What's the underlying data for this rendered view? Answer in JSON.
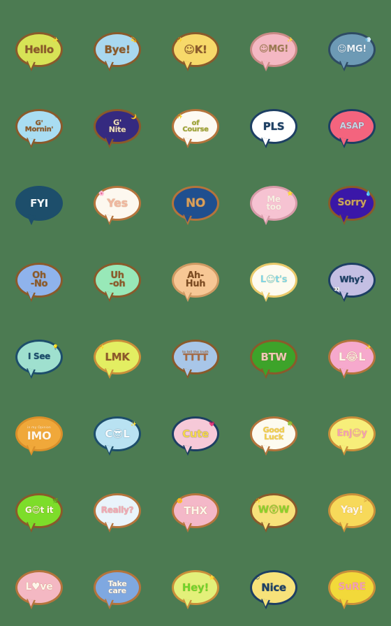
{
  "canvas": {
    "background_color": "#4c7b52",
    "columns": 5,
    "rows": 8,
    "total_stickers": 40
  },
  "stickers": [
    {
      "text": "Hello",
      "sub": "",
      "bubble_color": "#d7e356",
      "border_color": "#8a5a2b",
      "text_color": "#8a5a2b",
      "deco": "✨",
      "deco_pos": "tr",
      "font_size": "15px"
    },
    {
      "text": "Bye!",
      "sub": "",
      "bubble_color": "#a9d8ef",
      "border_color": "#8a5a2b",
      "text_color": "#8a5a2b",
      "deco": "💫",
      "deco_pos": "tr",
      "font_size": "15px"
    },
    {
      "text": "☺K!",
      "sub": "",
      "bubble_color": "#f7d96a",
      "border_color": "#8a5a2b",
      "text_color": "#8a5a2b",
      "deco": "✨",
      "deco_pos": "tl",
      "font_size": "15px"
    },
    {
      "text": "☺MG!",
      "sub": "",
      "bubble_color": "#f4b8c3",
      "border_color": "#c98a86",
      "text_color": "#9a7a52",
      "deco": "✨",
      "deco_pos": "tr",
      "font_size": "13px"
    },
    {
      "text": "☺MG!",
      "sub": "",
      "bubble_color": "#6d9ab5",
      "border_color": "#2e4b63",
      "text_color": "#eaf2f7",
      "deco": "💨",
      "deco_pos": "tr",
      "font_size": "13px"
    },
    {
      "text": "G'\nMornin'",
      "sub": "",
      "bubble_color": "#a9ddf2",
      "border_color": "#8a5a2b",
      "text_color": "#8a5a2b",
      "deco": "☀",
      "deco_pos": "tr",
      "font_size": "10px"
    },
    {
      "text": "G'\nNite",
      "sub": "",
      "bubble_color": "#352a80",
      "border_color": "#8a5a2b",
      "text_color": "#e8dcc0",
      "deco": "🌙",
      "deco_pos": "tr",
      "font_size": "11px"
    },
    {
      "text": "of\nCourse",
      "sub": "",
      "bubble_color": "#fdfaf2",
      "border_color": "#b4743c",
      "text_color": "#9aab3a",
      "deco": "✨",
      "deco_pos": "tl",
      "font_size": "10px"
    },
    {
      "text": "PLS",
      "sub": "",
      "bubble_color": "#ffffff",
      "border_color": "#1d3f63",
      "text_color": "#1d3f63",
      "deco": "✦",
      "deco_pos": "tr",
      "font_size": "15px"
    },
    {
      "text": "ASAP",
      "sub": "",
      "bubble_color": "#f4647e",
      "border_color": "#1d3f63",
      "text_color": "#c9d6e3",
      "deco": "",
      "deco_pos": "tr",
      "font_size": "12px"
    },
    {
      "text": "FYI",
      "sub": "",
      "bubble_color": "#1d4e6b",
      "border_color": "#1d4e6b",
      "text_color": "#eef4f7",
      "deco": "",
      "deco_pos": "tr",
      "font_size": "15px"
    },
    {
      "text": "Yes",
      "sub": "",
      "bubble_color": "#fdf8ef",
      "border_color": "#b4743c",
      "text_color": "#f0b8a0",
      "deco": "🌸",
      "deco_pos": "tl",
      "font_size": "16px"
    },
    {
      "text": "NO",
      "sub": "",
      "bubble_color": "#1f4f8f",
      "border_color": "#b4743c",
      "text_color": "#d9a05a",
      "deco": "",
      "deco_pos": "tr",
      "font_size": "17px"
    },
    {
      "text": "Me\ntoo",
      "sub": "",
      "bubble_color": "#f6c3d2",
      "border_color": "#d79aa8",
      "text_color": "#f7efe2",
      "deco": "⭐",
      "deco_pos": "tr",
      "font_size": "12px"
    },
    {
      "text": "Sorry",
      "sub": "",
      "bubble_color": "#3a17a8",
      "border_color": "#8a5a2b",
      "text_color": "#c9a45f",
      "deco": "💧",
      "deco_pos": "tr",
      "font_size": "14px"
    },
    {
      "text": "Oh\n-No",
      "sub": "",
      "bubble_color": "#8fb3ec",
      "border_color": "#8a5a2b",
      "text_color": "#8a5a2b",
      "deco": "",
      "deco_pos": "tr",
      "font_size": "13px"
    },
    {
      "text": "Uh\n-oh",
      "sub": "",
      "bubble_color": "#98e8b8",
      "border_color": "#8a5a2b",
      "text_color": "#8a5a2b",
      "deco": "",
      "deco_pos": "tr",
      "font_size": "13px"
    },
    {
      "text": "Ah-\nHuh",
      "sub": "",
      "bubble_color": "#f7c795",
      "border_color": "#cf9a63",
      "text_color": "#7a4a22",
      "deco": "",
      "deco_pos": "tr",
      "font_size": "13px"
    },
    {
      "text": "L☺t's",
      "sub": "",
      "bubble_color": "#fdfbf0",
      "border_color": "#e9c96a",
      "text_color": "#7fd4e8",
      "deco": "",
      "deco_pos": "tr",
      "font_size": "13px"
    },
    {
      "text": "Why?",
      "sub": "",
      "bubble_color": "#c4bfe3",
      "border_color": "#1d3f63",
      "text_color": "#1d3f63",
      "deco": "👀",
      "deco_pos": "bl",
      "font_size": "12px"
    },
    {
      "text": "I See",
      "sub": "",
      "bubble_color": "#9fe0cf",
      "border_color": "#1d4e6b",
      "text_color": "#1d4e6b",
      "deco": "💡",
      "deco_pos": "tr",
      "font_size": "12px"
    },
    {
      "text": "LMK",
      "sub": "",
      "bubble_color": "#e3ee62",
      "border_color": "#c98f3a",
      "text_color": "#8a5a2b",
      "deco": "✨",
      "deco_pos": "tl",
      "font_size": "15px"
    },
    {
      "text": "TTTT",
      "sub": "to tell the truth",
      "bubble_color": "#a8c6e8",
      "border_color": "#8a5a2b",
      "text_color": "#a66a46",
      "deco": "",
      "deco_pos": "tr",
      "font_size": "13px"
    },
    {
      "text": "BTW",
      "sub": "",
      "bubble_color": "#3da32a",
      "border_color": "#8a5a2b",
      "text_color": "#f0c9b8",
      "deco": "",
      "deco_pos": "tr",
      "font_size": "15px"
    },
    {
      "text": "L😂L",
      "sub": "",
      "bubble_color": "#f6a9cd",
      "border_color": "#b4743c",
      "text_color": "#fdf6ea",
      "deco": "✨",
      "deco_pos": "tr",
      "font_size": "16px"
    },
    {
      "text": "IMO",
      "sub": "in my Opinion",
      "bubble_color": "#f0a83a",
      "border_color": "#d98f2a",
      "text_color": "#fdf6ea",
      "deco": "",
      "deco_pos": "tr",
      "font_size": "16px"
    },
    {
      "text": "C😎L",
      "sub": "",
      "bubble_color": "#b9e2f2",
      "border_color": "#1d4e6b",
      "text_color": "#f7fbfd",
      "deco": "✨",
      "deco_pos": "tr",
      "font_size": "15px"
    },
    {
      "text": "Cute",
      "sub": "",
      "bubble_color": "#f6c9d8",
      "border_color": "#1d3f63",
      "text_color": "#f7d84a",
      "deco": "💗",
      "deco_pos": "tr",
      "font_size": "15px"
    },
    {
      "text": "Good\nLuck",
      "sub": "",
      "bubble_color": "#fdfbf0",
      "border_color": "#b4743c",
      "text_color": "#f2d24a",
      "deco": "🍀",
      "deco_pos": "tr",
      "font_size": "11px"
    },
    {
      "text": "Enj☺y",
      "sub": "",
      "bubble_color": "#f7ee7a",
      "border_color": "#c98f3a",
      "text_color": "#f2a0b4",
      "deco": "",
      "deco_pos": "tr",
      "font_size": "13px"
    },
    {
      "text": "G☺t it",
      "sub": "",
      "bubble_color": "#7ddd2a",
      "border_color": "#8a5a2b",
      "text_color": "#fdfbe8",
      "deco": "🌿",
      "deco_pos": "tr",
      "font_size": "12px"
    },
    {
      "text": "Really?",
      "sub": "",
      "bubble_color": "#eaf4fb",
      "border_color": "#b4743c",
      "text_color": "#f0a8b8",
      "deco": "",
      "deco_pos": "tr",
      "font_size": "12px"
    },
    {
      "text": "THX",
      "sub": "",
      "bubble_color": "#f4b8c8",
      "border_color": "#b4743c",
      "text_color": "#fdf6ea",
      "deco": "🌼",
      "deco_pos": "tl",
      "font_size": "15px"
    },
    {
      "text": "W😲W",
      "sub": "",
      "bubble_color": "#f7e27a",
      "border_color": "#8a5a2b",
      "text_color": "#8dd42a",
      "deco": "✨",
      "deco_pos": "tl",
      "font_size": "14px"
    },
    {
      "text": "Yay!",
      "sub": "",
      "bubble_color": "#f7d95a",
      "border_color": "#c98f3a",
      "text_color": "#fdf6ea",
      "deco": "><",
      "deco_pos": "tr",
      "font_size": "14px"
    },
    {
      "text": "L♥ve",
      "sub": "",
      "bubble_color": "#f4b8c3",
      "border_color": "#b4743c",
      "text_color": "#fdf6ea",
      "deco": "",
      "deco_pos": "tr",
      "font_size": "14px"
    },
    {
      "text": "Take\ncare",
      "sub": "",
      "bubble_color": "#7fa8e0",
      "border_color": "#b4743c",
      "text_color": "#fdfbf0",
      "deco": "",
      "deco_pos": "tr",
      "font_size": "11px"
    },
    {
      "text": "Hey!",
      "sub": "",
      "bubble_color": "#e3f07a",
      "border_color": "#c98f3a",
      "text_color": "#6fd42a",
      "deco": "⭐",
      "deco_pos": "tr",
      "font_size": "15px"
    },
    {
      "text": "Nice",
      "sub": "",
      "bubble_color": "#f7e27a",
      "border_color": "#1d3f63",
      "text_color": "#1d3f63",
      "deco": "☺",
      "deco_pos": "tl",
      "font_size": "15px"
    },
    {
      "text": "SuRE",
      "sub": "",
      "bubble_color": "#f2d93a",
      "border_color": "#c98f3a",
      "text_color": "#f2a0b4",
      "deco": "",
      "deco_pos": "tr",
      "font_size": "14px"
    }
  ]
}
